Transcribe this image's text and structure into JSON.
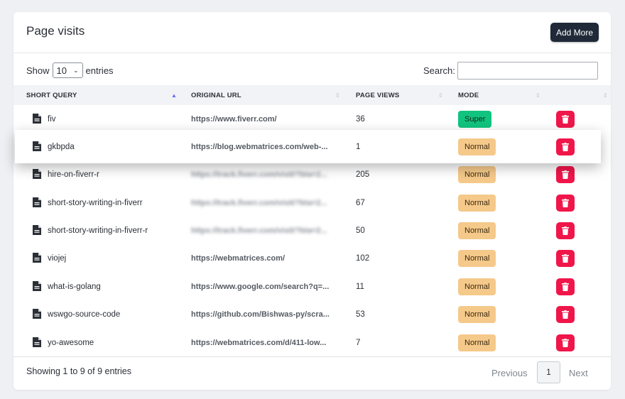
{
  "card": {
    "title": "Page visits",
    "add_button": "Add More"
  },
  "controls": {
    "show_label": "Show",
    "entries_value": "10",
    "entries_label": "entries",
    "search_label": "Search:",
    "search_value": ""
  },
  "table": {
    "columns": [
      "SHORT QUERY",
      "ORIGINAL URL",
      "PAGE VIEWS",
      "MODE"
    ],
    "sorted_column": "SHORT QUERY",
    "rows": [
      {
        "query": "fiv",
        "url": "https://www.fiverr.com/",
        "views": "36",
        "mode": "Super"
      },
      {
        "query": "gkbpda",
        "url": "https://blog.webmatrices.com/web-...",
        "views": "1",
        "mode": "Normal"
      },
      {
        "query": "hire-on-fiverr-r",
        "url": "https://track.fiverr.com/visit/?bta=2...",
        "views": "205",
        "mode": "Normal"
      },
      {
        "query": "short-story-writing-in-fiverr",
        "url": "https://track.fiverr.com/visit/?bta=2...",
        "views": "67",
        "mode": "Normal"
      },
      {
        "query": "short-story-writing-in-fiverr-r",
        "url": "https://track.fiverr.com/visit/?bta=2...",
        "views": "50",
        "mode": "Normal"
      },
      {
        "query": "viojej",
        "url": "https://webmatrices.com/",
        "views": "102",
        "mode": "Normal"
      },
      {
        "query": "what-is-golang",
        "url": "https://www.google.com/search?q=...",
        "views": "11",
        "mode": "Normal"
      },
      {
        "query": "wswgo-source-code",
        "url": "https://github.com/Bishwas-py/scra...",
        "views": "53",
        "mode": "Normal"
      },
      {
        "query": "yo-awesome",
        "url": "https://webmatrices.com/d/411-low...",
        "views": "7",
        "mode": "Normal"
      }
    ]
  },
  "footer": {
    "info": "Showing 1 to 9 of 9 entries",
    "previous": "Previous",
    "current_page": "1",
    "next": "Next"
  },
  "colors": {
    "add_button_bg": "#1f2937",
    "super_badge": "#10c37e",
    "normal_badge": "#f5c98a",
    "delete_button": "#f0164a",
    "sort_active": "#6366f1"
  },
  "icons": {
    "row_icon": "document-icon",
    "action_icon": "trash-icon",
    "sort_icon": "sort-arrows-icon"
  }
}
